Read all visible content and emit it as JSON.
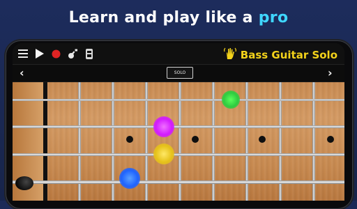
{
  "headline": {
    "prefix": "Learn and play like a ",
    "accent": "pro"
  },
  "toolbar": {
    "icons": [
      "menu-icon",
      "play-icon",
      "record-icon",
      "guitar-icon",
      "metronome-icon"
    ],
    "record_color": "#e02424",
    "app_title": "Bass Guitar Solo",
    "app_title_color": "#f3d21a"
  },
  "nav": {
    "prev_glyph": "‹",
    "next_glyph": "›",
    "mode_button": "SOLO"
  },
  "fretboard": {
    "strings": 4,
    "frets_visible": 9,
    "marker_frets": [
      3,
      5,
      7,
      9
    ],
    "notes": [
      {
        "string": 1,
        "fret": 6,
        "color": "#2ecc40"
      },
      {
        "string": 2,
        "fret": 4,
        "color": "#d21aff"
      },
      {
        "string": 3,
        "fret": 4,
        "color": "#e6c21a"
      },
      {
        "string": 4,
        "fret": 3,
        "color": "#1e63ff"
      }
    ]
  }
}
